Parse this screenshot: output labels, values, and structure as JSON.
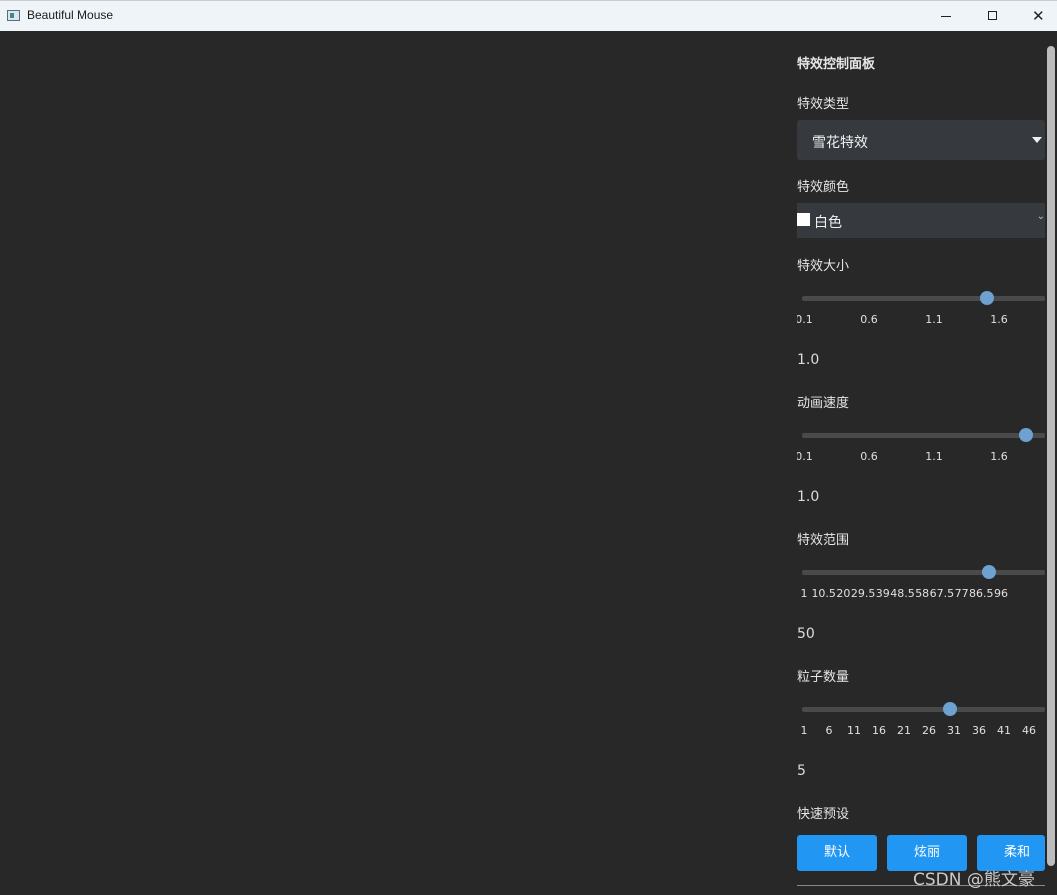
{
  "window": {
    "title": "Beautiful Mouse",
    "minimize_glyph": "minimize-icon",
    "maximize_glyph": "maximize-icon",
    "close_glyph": "✕"
  },
  "panel": {
    "heading": "特效控制面板",
    "effect_type": {
      "label": "特效类型",
      "selected": "雪花特效"
    },
    "effect_color": {
      "label": "特效颜色",
      "selected": "白色",
      "swatch_color": "#ffffff"
    },
    "effect_size": {
      "label": "特效大小",
      "ticks": [
        "0.1",
        "0.6",
        "1.1",
        "1.6"
      ],
      "slider_level": 0.76,
      "value": "1.0"
    },
    "anim_speed": {
      "label": "动画速度",
      "ticks": [
        "0.1",
        "0.6",
        "1.1",
        "1.6"
      ],
      "slider_level": 0.92,
      "value": "1.0"
    },
    "effect_range": {
      "label": "特效范围",
      "ticks": [
        "1",
        "10.5",
        "20",
        "29.5",
        "39",
        "48.5",
        "58",
        "67.5",
        "77",
        "86.5",
        "96"
      ],
      "slider_level": 0.77,
      "value": "50"
    },
    "particle_count": {
      "label": "粒子数量",
      "ticks": [
        "1",
        "6",
        "11",
        "16",
        "21",
        "26",
        "31",
        "36",
        "41",
        "46"
      ],
      "slider_level": 0.61,
      "value": "5"
    },
    "presets": {
      "label": "快速预设",
      "buttons": [
        "默认",
        "炫丽",
        "柔和"
      ]
    }
  },
  "watermark": "CSDN @熊文豪",
  "colors": {
    "background": "#282828",
    "accent": "#2196f3",
    "slider_thumb": "#6da1cf"
  }
}
